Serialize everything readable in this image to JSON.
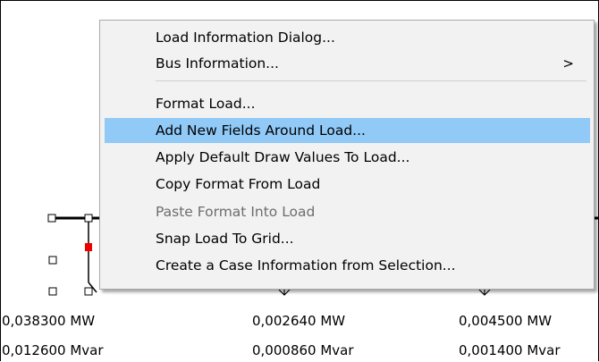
{
  "context_menu": {
    "items": [
      {
        "label": "Load Information Dialog...",
        "state": "normal"
      },
      {
        "label": "Bus Information...",
        "state": "normal",
        "submenu_arrow": ">"
      },
      {
        "label": "Format Load...",
        "state": "normal"
      },
      {
        "label": "Add New Fields Around Load...",
        "state": "highlighted"
      },
      {
        "label": "Apply Default Draw Values To Load...",
        "state": "normal"
      },
      {
        "label": "Copy Format From Load",
        "state": "normal"
      },
      {
        "label": "Paste Format Into Load",
        "state": "disabled"
      },
      {
        "label": "Snap Load To Grid...",
        "state": "normal"
      },
      {
        "label": "Create a Case Information from Selection...",
        "state": "normal"
      }
    ],
    "highlight_color": "#91c9f7",
    "background_color": "#f2f2f2",
    "disabled_text_color": "#6d6d6d"
  },
  "loads": [
    {
      "mw": "0,038300 MW",
      "mvar": "0,012600 Mvar"
    },
    {
      "mw": "0,002640 MW",
      "mvar": "0,000860 Mvar"
    },
    {
      "mw": "0,004500 MW",
      "mvar": "0,001400 Mvar"
    }
  ],
  "diagram": {
    "selected_marker_color": "#ee0000",
    "line_color": "#000000"
  }
}
